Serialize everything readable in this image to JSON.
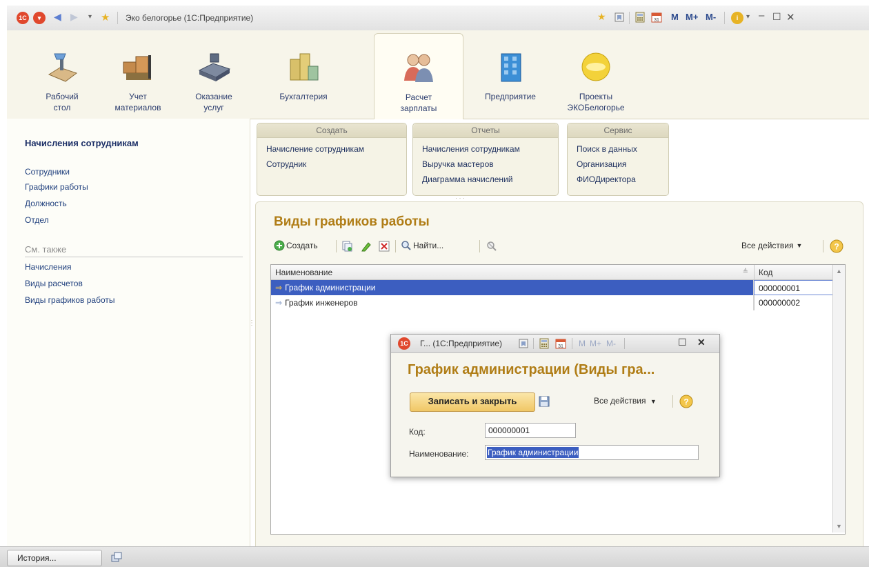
{
  "window": {
    "title": "Эко белогорье  (1С:Предприятие)",
    "memory_buttons": [
      "M",
      "M+",
      "M-"
    ]
  },
  "sections": [
    {
      "label": "Рабочий\nстол",
      "icon": "desk-lamp-icon"
    },
    {
      "label": "Учет\nматериалов",
      "icon": "warehouse-boxes-icon"
    },
    {
      "label": "Оказание\nуслуг",
      "icon": "cash-register-icon"
    },
    {
      "label": "Бухгалтерия",
      "icon": "coins-icon"
    },
    {
      "label": "Расчет\nзарплаты",
      "icon": "people-icon",
      "active": true
    },
    {
      "label": "Предприятие",
      "icon": "building-icon"
    },
    {
      "label": "Проекты\nЭКОБелогорье",
      "icon": "gold-disc-icon"
    }
  ],
  "leftnav": {
    "title": "Начисления сотрудникам",
    "links": [
      "Сотрудники",
      "Графики работы",
      "Должность",
      "Отдел"
    ],
    "see_also_header": "См. также",
    "see_also": [
      "Начисления",
      "Виды расчетов",
      "Виды графиков работы"
    ]
  },
  "command_groups": [
    {
      "header": "Создать",
      "items": [
        "Начисление сотрудникам",
        "Сотрудник"
      ]
    },
    {
      "header": "Отчеты",
      "items": [
        "Начисления сотрудникам",
        "Выручка мастеров",
        "Диаграмма начислений"
      ]
    },
    {
      "header": "Сервис",
      "items": [
        "Поиск в данных",
        "Организация",
        "ФИОДиректора"
      ]
    }
  ],
  "list_form": {
    "title": "Виды графиков работы",
    "toolbar": {
      "create": "Создать",
      "find": "Найти...",
      "all_actions": "Все действия"
    },
    "columns": [
      "Наименование",
      "Код"
    ],
    "rows": [
      {
        "name": "График администрации",
        "code": "000000001",
        "selected": true
      },
      {
        "name": "График инженеров",
        "code": "000000002",
        "selected": false
      }
    ]
  },
  "modal": {
    "window_title": "Г... (1С:Предприятие)",
    "memory_buttons": [
      "M",
      "M+",
      "M-"
    ],
    "title": "График администрации (Виды гра...",
    "save_close_button": "Записать и закрыть",
    "all_actions": "Все действия",
    "code_label": "Код:",
    "code_value": "000000001",
    "name_label": "Наименование:",
    "name_value": "График администрации"
  },
  "statusbar": {
    "history_button": "История..."
  },
  "colors": {
    "accent_title": "#b07d16",
    "selection": "#3c5ec0",
    "link": "#1f3f7d"
  }
}
